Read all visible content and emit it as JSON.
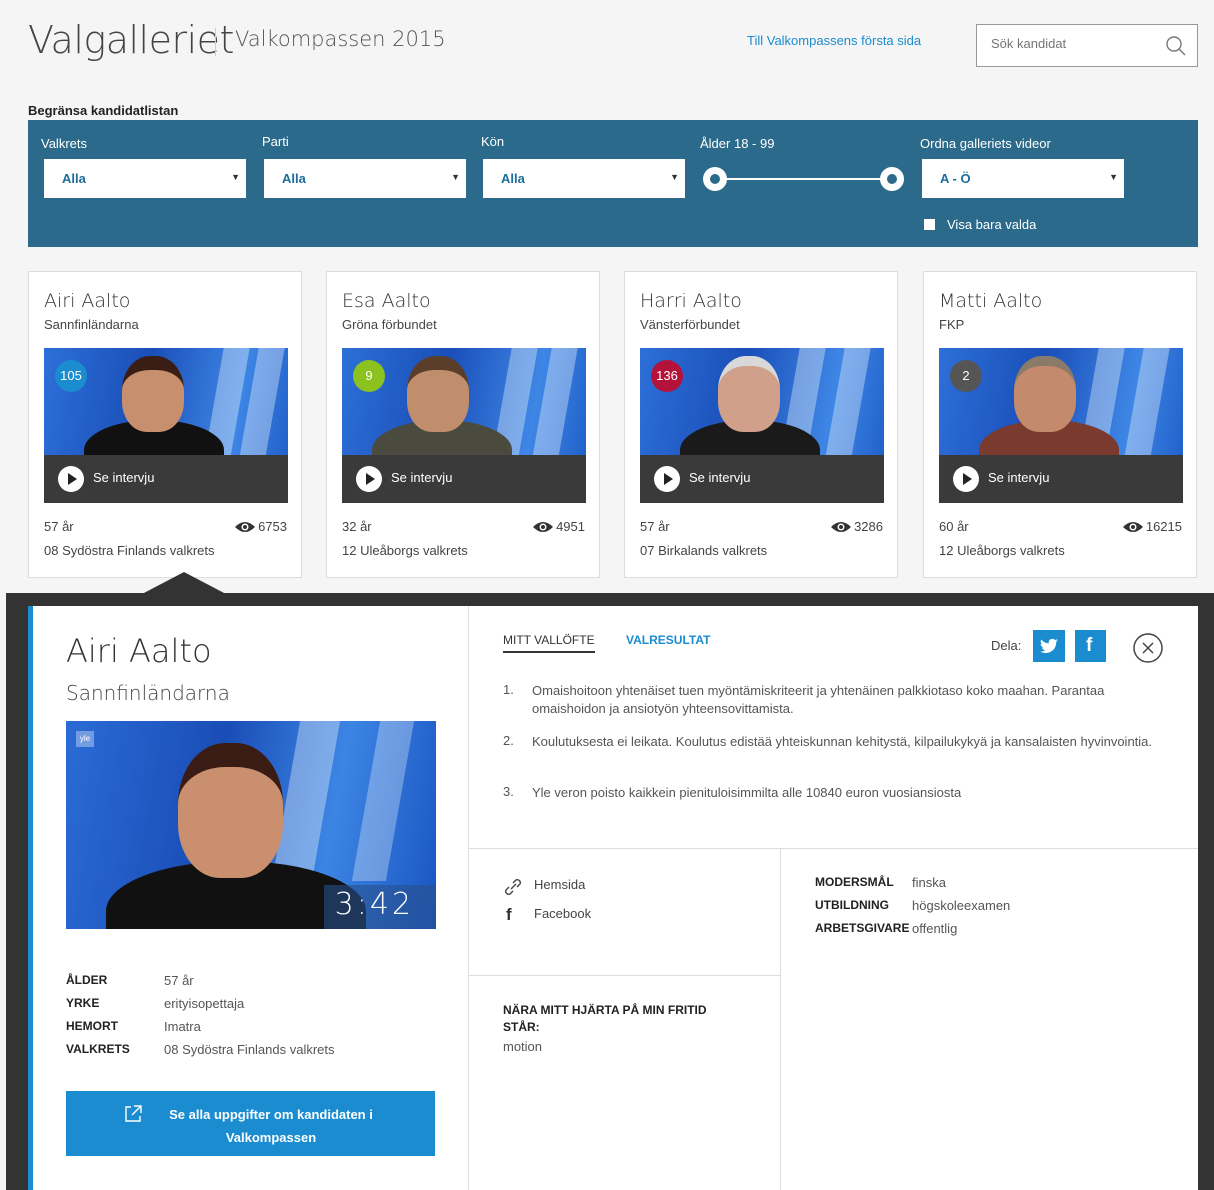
{
  "header": {
    "title": "Valgalleriet",
    "subtitle": "Valkompassen 2015",
    "front_link": "Till Valkompassens första sida",
    "search_placeholder": "Sök kandidat"
  },
  "filters": {
    "heading": "Begränsa kandidatlistan",
    "valkrets_label": "Valkrets",
    "valkrets_value": "Alla",
    "parti_label": "Parti",
    "parti_value": "Alla",
    "kon_label": "Kön",
    "kon_value": "Alla",
    "age_label": "Ålder 18 - 99",
    "age_range": [
      18,
      99
    ],
    "order_label": "Ordna galleriets videor",
    "order_value": "A - Ö",
    "only_elected_label": "Visa bara valda",
    "only_elected_checked": false
  },
  "cards": [
    {
      "name": "Airi Aalto",
      "party": "Sannfinländarna",
      "badge": "105",
      "badge_color": "#1a8ccf",
      "watch": "Se intervju",
      "age": "57 år",
      "views": "6753",
      "district": "08 Sydöstra Finlands valkrets"
    },
    {
      "name": "Esa Aalto",
      "party": "Gröna förbundet",
      "badge": "9",
      "badge_color": "#8cc21f",
      "watch": "Se intervju",
      "age": "32 år",
      "views": "4951",
      "district": "12 Uleåborgs valkrets"
    },
    {
      "name": "Harri Aalto",
      "party": "Vänsterförbundet",
      "badge": "136",
      "badge_color": "#b4123a",
      "watch": "Se intervju",
      "age": "57 år",
      "views": "3286",
      "district": "07 Birkalands valkrets"
    },
    {
      "name": "Matti Aalto",
      "party": "FKP",
      "badge": "2",
      "badge_color": "#555555",
      "watch": "Se intervju",
      "age": "60 år",
      "views": "16215",
      "district": "12 Uleåborgs valkrets"
    }
  ],
  "detail": {
    "name": "Airi Aalto",
    "party": "Sannfinländarna",
    "video_duration": "3:42",
    "facts": [
      {
        "key": "ÅLDER",
        "value": "57 år"
      },
      {
        "key": "YRKE",
        "value": "erityisopettaja"
      },
      {
        "key": "HEMORT",
        "value": "Imatra"
      },
      {
        "key": "VALKRETS",
        "value": "08 Sydöstra Finlands valkrets"
      }
    ],
    "all_info_button": "Se alla uppgifter om kandidaten i Valkompassen",
    "tabs": [
      "MITT VALLÖFTE",
      "VALRESULTAT"
    ],
    "share_label": "Dela:",
    "promises": [
      {
        "num": "1.",
        "text": "Omaishoitoon yhtenäiset tuen myöntämiskriteerit ja yhtenäinen palkkiotaso koko maahan. Parantaa omaishoidon ja ansiotyön yhteensovittamista."
      },
      {
        "num": "2.",
        "text": "Koulutuksesta ei leikata. Koulutus edistää yhteiskunnan kehitystä, kilpailukykyä ja kansalaisten hyvinvointia."
      },
      {
        "num": "3.",
        "text": "Yle veron poisto kaikkein pienituloisimmilta alle 10840 euron vuosiansiosta"
      }
    ],
    "links": {
      "homepage": "Hemsida",
      "facebook": "Facebook"
    },
    "info": [
      {
        "key": "MODERSMÅL",
        "value": "finska"
      },
      {
        "key": "UTBILDNING",
        "value": "högskoleexamen"
      },
      {
        "key": "ARBETSGIVARE",
        "value": "offentlig"
      }
    ],
    "heart_title": "NÄRA MITT HJÄRTA PÅ MIN FRITID STÅR:",
    "heart_value": "motion"
  }
}
